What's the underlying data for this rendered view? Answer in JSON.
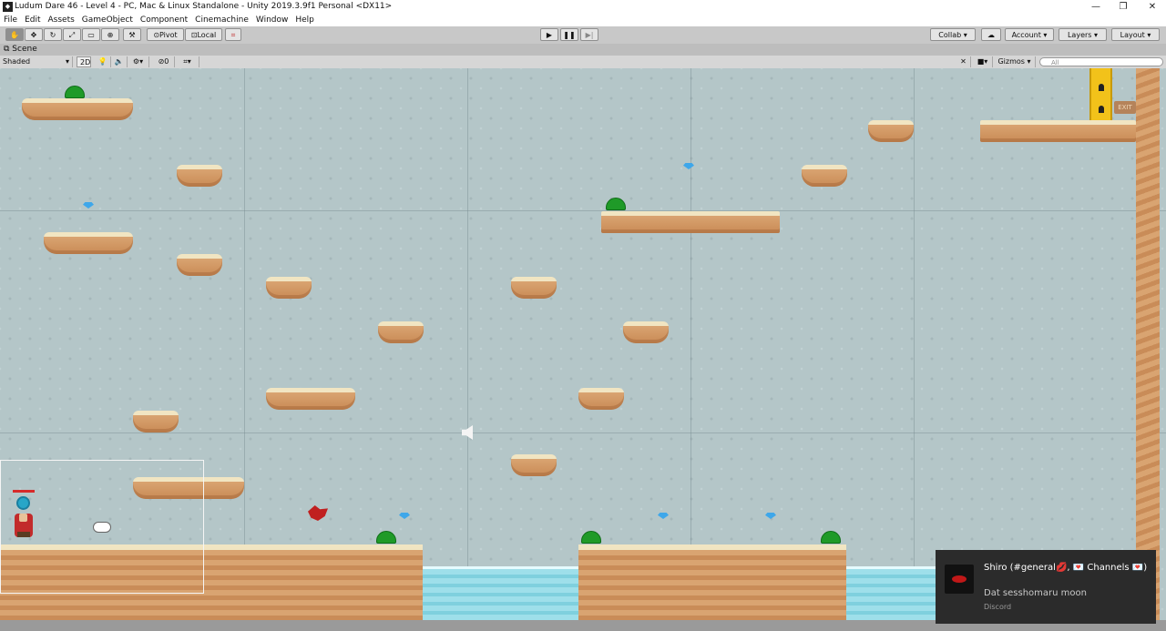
{
  "window": {
    "title": "Ludum Dare 46 - Level 4 - PC, Mac & Linux Standalone - Unity 2019.3.9f1 Personal <DX11>",
    "minimize": "—",
    "maximize": "❐",
    "close": "✕"
  },
  "menu": [
    "File",
    "Edit",
    "Assets",
    "GameObject",
    "Component",
    "Cinemachine",
    "Window",
    "Help"
  ],
  "toolbar": {
    "pivot": "Pivot",
    "local": "Local",
    "collab": "Collab ▾",
    "account": "Account",
    "layers": "Layers",
    "layout": "Layout"
  },
  "scene_tab": {
    "label": "Scene"
  },
  "scene_toolbar": {
    "shading": "Shaded",
    "mode_2d": "2D",
    "hidden_count": "0",
    "gizmos": "Gizmos",
    "search_placeholder": "All"
  },
  "level": {
    "exit_sign": "EXIT"
  },
  "toast": {
    "title": "Shiro (#general💋, 💌 Channels 💌)",
    "message": "Dat sesshomaru moon",
    "app": "Discord"
  }
}
